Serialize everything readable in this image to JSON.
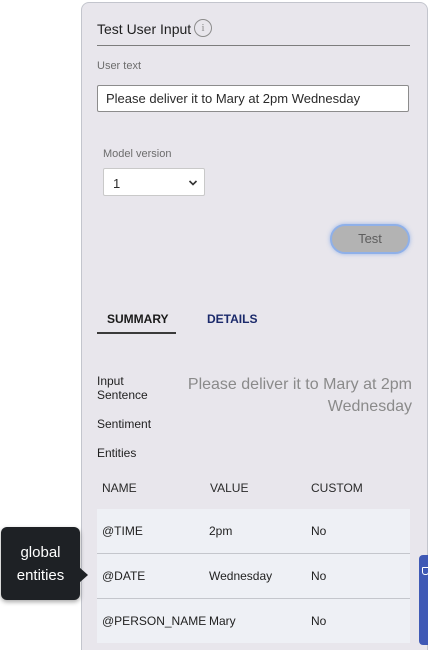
{
  "panel": {
    "title": "Test User Input",
    "info_icon": "info-icon"
  },
  "user_text": {
    "label": "User text",
    "value": "Please deliver it to Mary at 2pm Wednesday"
  },
  "model_version": {
    "label": "Model version",
    "selected": "1"
  },
  "test_button": {
    "label": "Test"
  },
  "tabs": [
    {
      "label": "SUMMARY",
      "active": true
    },
    {
      "label": "DETAILS",
      "active": false
    }
  ],
  "summary": {
    "input_sentence_label_line1": "Input",
    "input_sentence_label_line2": "Sentence",
    "input_sentence_value": "Please deliver it to Mary at 2pm Wednesday",
    "sentiment_label": "Sentiment",
    "entities_label": "Entities"
  },
  "entities_table": {
    "columns": [
      "NAME",
      "VALUE",
      "CUSTOM"
    ],
    "rows": [
      {
        "name": "@TIME",
        "value": "2pm",
        "custom": "No"
      },
      {
        "name": "@DATE",
        "value": "Wednesday",
        "custom": "No"
      },
      {
        "name": "@PERSON_NAME",
        "value": "Mary",
        "custom": "No"
      }
    ]
  },
  "callout": {
    "line1": "global",
    "line2": "entities"
  },
  "colors": {
    "panel_bg": "#e8e6ec",
    "row_bg": "#eef0f5",
    "callout_bg": "#1e2125",
    "details_tab": "#1b2a6b",
    "edge_widget": "#3f59b5"
  }
}
